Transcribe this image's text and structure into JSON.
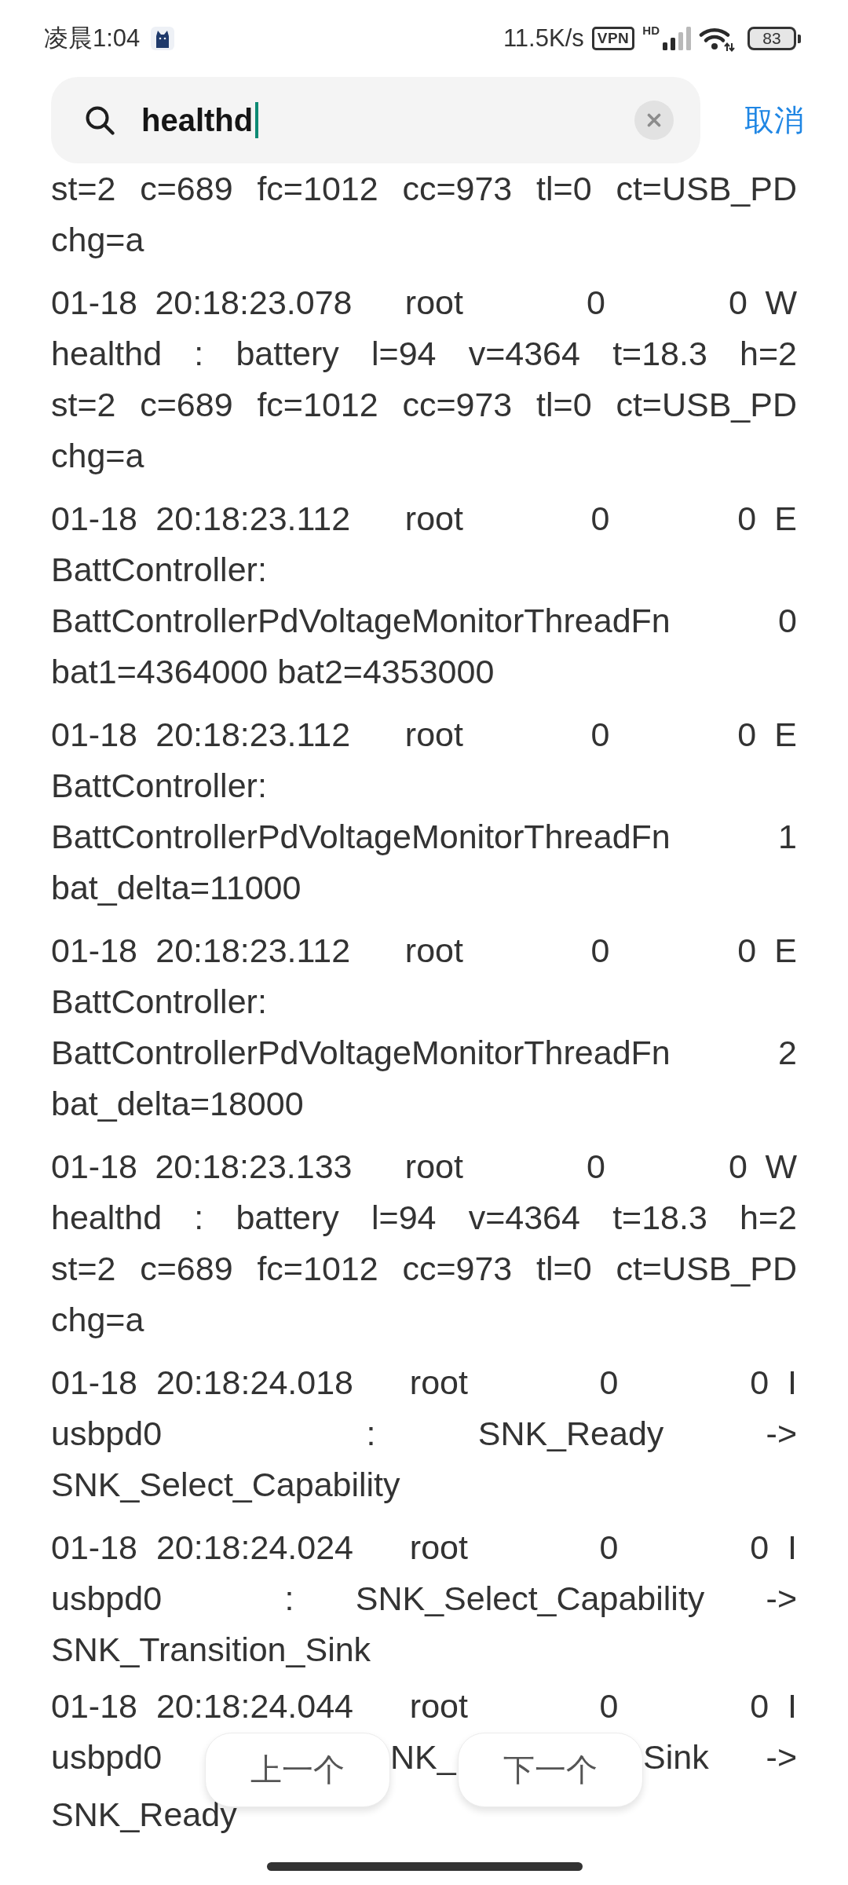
{
  "status_bar": {
    "time": "凌晨1:04",
    "net_speed": "11.5K/s",
    "vpn": "VPN",
    "network_type": "HD",
    "battery": "83"
  },
  "search": {
    "value": "healthd",
    "cancel": "取消"
  },
  "log_entries": [
    {
      "lines": [
        "st=2 c=689 fc=1012 cc=973 tl=0 ct=USB_PD",
        "chg=a"
      ]
    },
    {
      "lines": [
        "01-18 20:18:23.078   root       0       0 W",
        "healthd : battery l=94 v=4364 t=18.3 h=2",
        "st=2 c=689 fc=1012 cc=973 tl=0 ct=USB_PD",
        "chg=a"
      ]
    },
    {
      "lines": [
        "01-18 20:18:23.112   root       0       0 E",
        "BattController:",
        "BattControllerPdVoltageMonitorThreadFn 0",
        "bat1=4364000 bat2=4353000"
      ]
    },
    {
      "lines": [
        "01-18 20:18:23.112   root       0       0 E",
        "BattController:",
        "BattControllerPdVoltageMonitorThreadFn 1",
        "bat_delta=11000"
      ]
    },
    {
      "lines": [
        "01-18 20:18:23.112   root       0       0 E",
        "BattController:",
        "BattControllerPdVoltageMonitorThreadFn 2",
        "bat_delta=18000"
      ]
    },
    {
      "lines": [
        "01-18 20:18:23.133   root       0       0 W",
        "healthd : battery l=94 v=4364 t=18.3 h=2",
        "st=2 c=689 fc=1012 cc=973 tl=0 ct=USB_PD",
        "chg=a"
      ]
    },
    {
      "lines": [
        "01-18 20:18:24.018   root       0       0 I",
        "usbpd0  : SNK_Ready ->",
        "SNK_Select_Capability"
      ]
    },
    {
      "lines": [
        "01-18 20:18:24.024   root       0       0 I",
        "usbpd0  : SNK_Select_Capability ->",
        "SNK_Transition_Sink"
      ]
    },
    {
      "lines": [
        "01-18 20:18:24.044   root       0       0 I",
        [
          "usbpd0",
          "NK_",
          "Sink",
          "->"
        ],
        "SNK_Ready"
      ]
    }
  ],
  "navigation": {
    "previous": "上一个",
    "next": "下一个"
  }
}
